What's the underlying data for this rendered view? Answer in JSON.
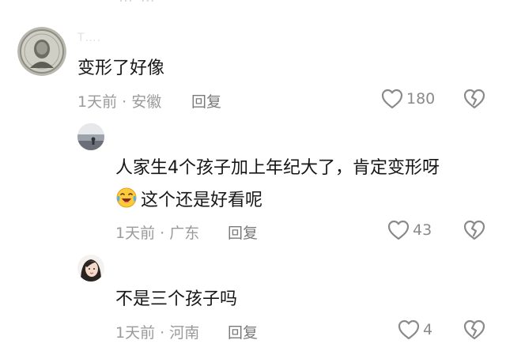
{
  "header_cut_text": "… …",
  "comments": [
    {
      "username": "T….",
      "text": "变形了好像",
      "time": "1天前",
      "location": "安徽",
      "reply_label": "回复",
      "likes": "180",
      "avatar": "coin-portrait"
    },
    {
      "username": "",
      "text_line1": "人家生4个孩子加上年纪大了，肯定变形呀",
      "emoji": "laughing-crying-emoji",
      "text_line2": "这个还是好看呢",
      "time": "1天前",
      "location": "广东",
      "reply_label": "回复",
      "likes": "43",
      "avatar": "landscape-photo"
    },
    {
      "username": "",
      "text": "不是三个孩子吗",
      "time": "1天前",
      "location": "河南",
      "reply_label": "回复",
      "likes": "4",
      "avatar": "woman-portrait"
    }
  ],
  "colors": {
    "text_primary": "#161616",
    "text_meta": "#9a9a9a",
    "icon_stroke": "#8a8a8a"
  }
}
